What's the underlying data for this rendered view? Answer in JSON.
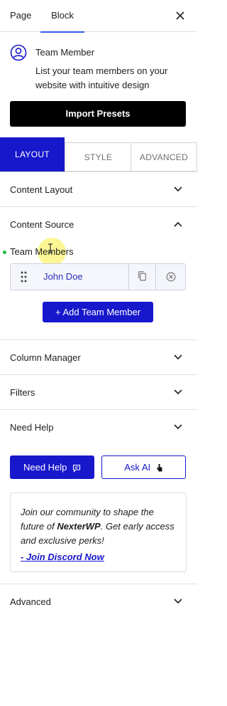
{
  "tabs": {
    "page": "Page",
    "block": "Block"
  },
  "block": {
    "title": "Team Member",
    "description": "List your team members on your website with intuitive design",
    "icon": "user-circle-icon"
  },
  "import_button": "Import Presets",
  "panel_tabs": {
    "layout": "LAYOUT",
    "style": "STYLE",
    "advanced": "ADVANCED"
  },
  "sections": {
    "content_layout": "Content Layout",
    "content_source": "Content Source",
    "column_manager": "Column Manager",
    "filters": "Filters",
    "need_help": "Need Help",
    "advanced": "Advanced"
  },
  "team_members": {
    "label": "Team Members",
    "items": [
      {
        "name": "John Doe"
      }
    ],
    "add_button": "+ Add Team Member"
  },
  "help": {
    "need_help_button": "Need Help",
    "ask_ai_button": "Ask AI",
    "community_pre": "Join our community to shape the future of ",
    "community_brand": "NexterWP",
    "community_post": ". Get early access and exclusive perks!",
    "discord_link": "- Join Discord Now"
  },
  "colors": {
    "accent": "#1717cc",
    "tab_underline": "#3858e9",
    "dot": "#22bb44"
  }
}
